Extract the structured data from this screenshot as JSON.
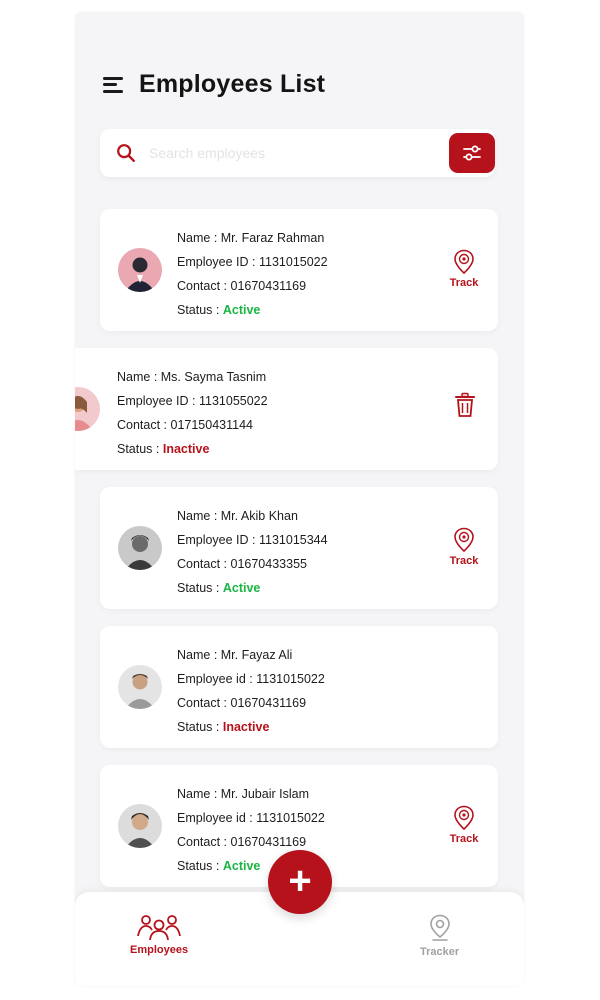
{
  "header": {
    "title": "Employees List"
  },
  "search": {
    "placeholder": "Search employees",
    "value": ""
  },
  "labels": {
    "name": "Name : ",
    "employee_id": "Employee ID : ",
    "employee_id_lower": "Employee id : ",
    "contact": "Contact : ",
    "status": "Status : "
  },
  "employees": [
    {
      "name": "Mr. Faraz Rahman",
      "employee_id": "1131015022",
      "contact": "01670431169",
      "status": "Active",
      "action": "Track"
    },
    {
      "name": "Ms. Sayma Tasnim",
      "employee_id": "1131055022",
      "contact": "017150431144",
      "status": "Inactive",
      "action": "delete"
    },
    {
      "name": "Mr. Akib Khan",
      "employee_id": "1131015344",
      "contact": "01670433355",
      "status": "Active",
      "action": "Track"
    },
    {
      "name": "Mr. Fayaz Ali",
      "employee_id": "1131015022",
      "contact": "01670431169",
      "status": "Inactive",
      "action": "none"
    },
    {
      "name": "Mr. Jubair Islam",
      "employee_id": "1131015022",
      "contact": "01670431169",
      "status": "Active",
      "action": "Track"
    }
  ],
  "bottom_nav": {
    "employees_label": "Employees",
    "tracker_label": "Tracker"
  },
  "colors": {
    "accent": "#b5121b",
    "active": "#1bb543",
    "inactive": "#b5121b",
    "background": "#f5f5f7"
  },
  "icons": {
    "menu": "menu-icon",
    "search": "search-icon",
    "filter": "sliders-icon",
    "track": "location-pin-icon",
    "delete": "trash-icon",
    "add": "plus-icon",
    "employees": "people-icon",
    "tracker": "map-pin-icon"
  }
}
